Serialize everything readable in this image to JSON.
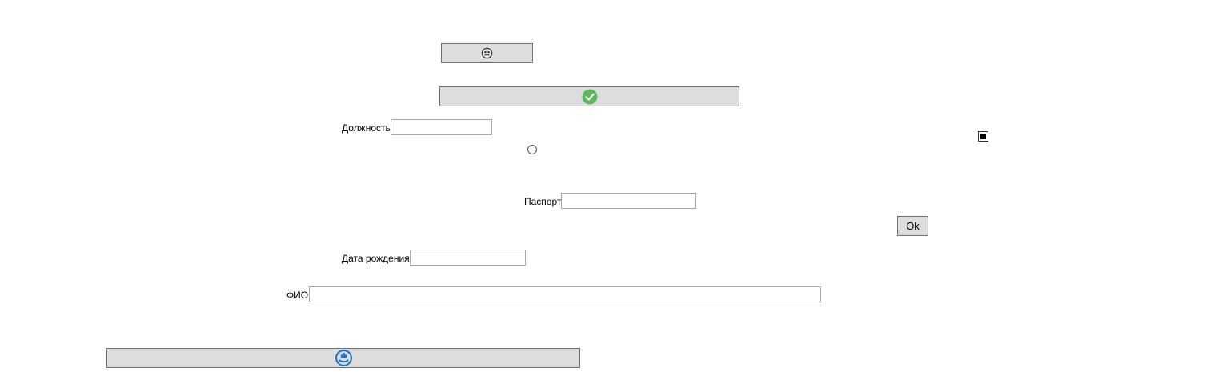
{
  "form": {
    "position_label": "Должность",
    "position_value": "",
    "passport_label": "Паспорт",
    "passport_value": "",
    "birthdate_label": "Дата рождения",
    "birthdate_value": "",
    "fullname_label": "ФИО",
    "fullname_value": "",
    "ok_label": "Ok",
    "checkbox_checked": true,
    "radio_selected": false
  },
  "icons": {
    "top_button": "sad-face-icon",
    "confirm_button": "green-checkmark-icon",
    "bottom_button": "blue-circle-icon"
  },
  "colors": {
    "button_bg": "#dddddd",
    "button_border": "#707070",
    "check_green": "#5cb85c",
    "bottom_icon_blue": "#1a73c8"
  }
}
